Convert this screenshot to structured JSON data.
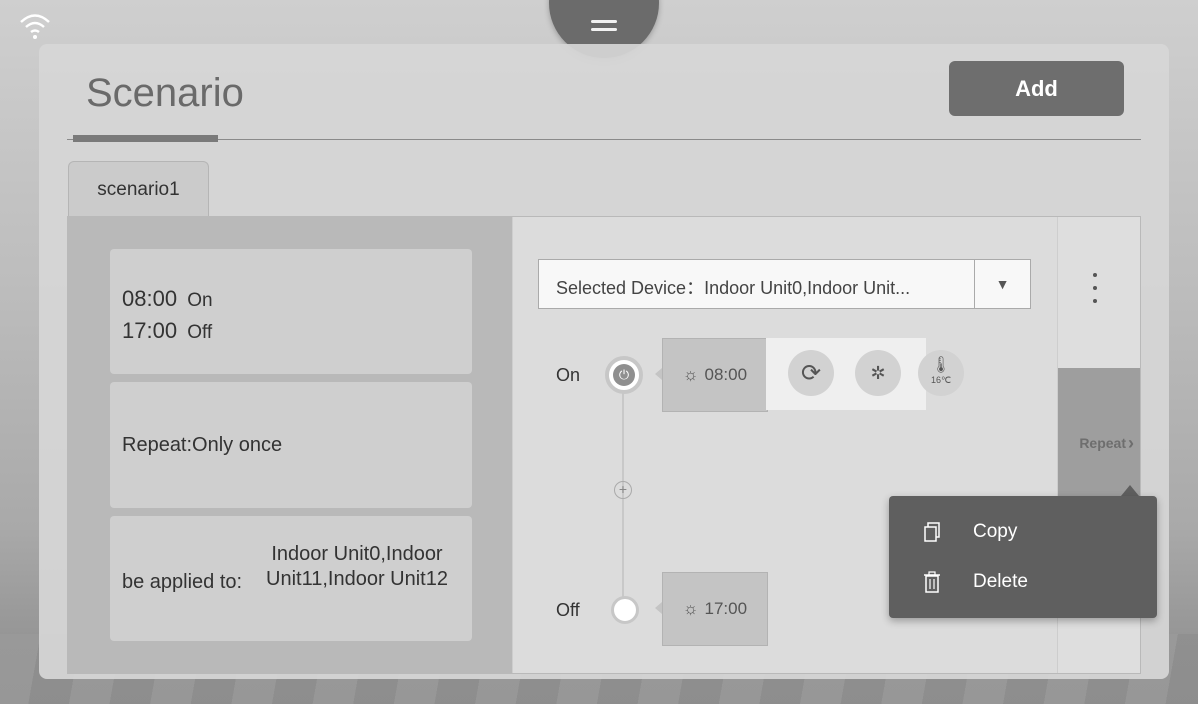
{
  "header": {
    "title": "Scenario",
    "add_label": "Add"
  },
  "tabs": [
    {
      "label": "scenario1"
    }
  ],
  "summary": {
    "on_time": "08:00",
    "on_state": "On",
    "off_time": "17:00",
    "off_state": "Off",
    "repeat": "Repeat:Only once",
    "applied_label": "be applied to:",
    "applied_value": "Indoor Unit0,Indoor Unit11,Indoor Unit12"
  },
  "editor": {
    "selected_device": "Selected Device：Indoor Unit0,Indoor Unit...",
    "on_label": "On",
    "off_label": "Off",
    "on_time": "08:00",
    "off_time": "17:00",
    "temp_badge": "16℃",
    "repeat_label": "Repeat"
  },
  "context_menu": {
    "copy_label": "Copy",
    "delete_label": "Delete"
  },
  "icons": [
    "wifi-icon",
    "menu-icon",
    "power-icon",
    "sun-icon",
    "refresh-icon",
    "fan-icon",
    "thermometer-icon",
    "plus-icon",
    "copy-icon",
    "trash-icon",
    "kebab-icon",
    "chevron-right-icon"
  ]
}
